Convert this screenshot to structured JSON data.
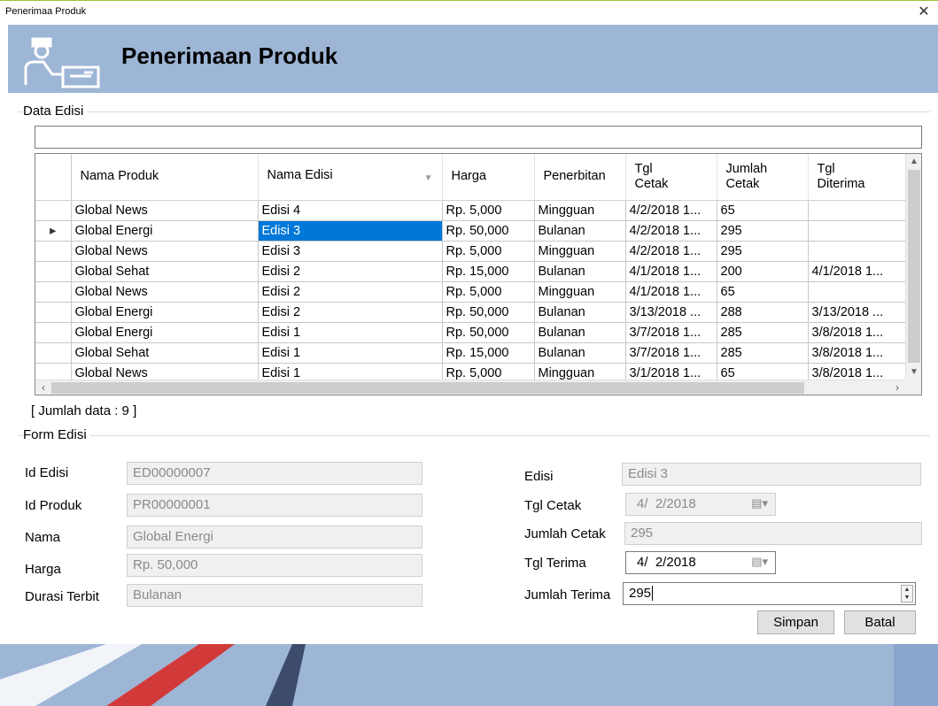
{
  "window": {
    "title": "Penerimaa Produk",
    "close_glyph": "✕"
  },
  "header": {
    "title": "Penerimaan Produk",
    "icon": "delivery-person-icon"
  },
  "data_edisi": {
    "group_label": "Data Edisi",
    "search_value": "",
    "columns": [
      "Nama Produk",
      "Nama Edisi",
      "Harga",
      "Penerbitan",
      "Tgl\nCetak",
      "Jumlah\nCetak",
      "Tgl\nDiterima"
    ],
    "rows": [
      [
        "Global News",
        "Edisi 4",
        "Rp. 5,000",
        "Mingguan",
        "4/2/2018 1...",
        "65",
        ""
      ],
      [
        "Global Energi",
        "Edisi 3",
        "Rp. 50,000",
        "Bulanan",
        "4/2/2018 1...",
        "295",
        ""
      ],
      [
        "Global News",
        "Edisi 3",
        "Rp. 5,000",
        "Mingguan",
        "4/2/2018 1...",
        "295",
        ""
      ],
      [
        "Global Sehat",
        "Edisi 2",
        "Rp. 15,000",
        "Bulanan",
        "4/1/2018 1...",
        "200",
        "4/1/2018 1..."
      ],
      [
        "Global News",
        "Edisi 2",
        "Rp. 5,000",
        "Mingguan",
        "4/1/2018 1...",
        "65",
        ""
      ],
      [
        "Global Energi",
        "Edisi 2",
        "Rp. 50,000",
        "Bulanan",
        "3/13/2018 ...",
        "288",
        "3/13/2018 ..."
      ],
      [
        "Global Energi",
        "Edisi 1",
        "Rp. 50,000",
        "Bulanan",
        "3/7/2018 1...",
        "285",
        "3/8/2018 1..."
      ],
      [
        "Global Sehat",
        "Edisi 1",
        "Rp. 15,000",
        "Bulanan",
        "3/7/2018 1...",
        "285",
        "3/8/2018 1..."
      ],
      [
        "Global News",
        "Edisi 1",
        "Rp. 5,000",
        "Mingguan",
        "3/1/2018 1...",
        "65",
        "3/8/2018 1..."
      ]
    ],
    "current_row_index": 1,
    "selected_cell": {
      "row": 1,
      "col": 1
    },
    "row_marker": "▸",
    "row_count_text": "[ Jumlah data : 9 ]"
  },
  "form_edisi": {
    "group_label": "Form Edisi",
    "id_edisi": {
      "label": "Id Edisi",
      "value": "ED00000007"
    },
    "id_produk": {
      "label": "Id Produk",
      "value": "PR00000001"
    },
    "nama": {
      "label": "Nama",
      "value": "Global Energi"
    },
    "harga": {
      "label": "Harga",
      "value": "Rp. 50,000"
    },
    "durasi_terbit": {
      "label": "Durasi Terbit",
      "value": "Bulanan"
    },
    "edisi": {
      "label": "Edisi",
      "value": "Edisi 3"
    },
    "tgl_cetak": {
      "label": "Tgl Cetak",
      "value": "4/  2/2018"
    },
    "jumlah_cetak": {
      "label": "Jumlah Cetak",
      "value": "295"
    },
    "tgl_terima": {
      "label": "Tgl Terima",
      "value": "4/  2/2018"
    },
    "jumlah_terima": {
      "label": "Jumlah Terima",
      "value": "295"
    },
    "simpan_label": "Simpan",
    "batal_label": "Batal"
  },
  "colors": {
    "banner": "#9eb6d6",
    "selection": "#0078d7"
  }
}
